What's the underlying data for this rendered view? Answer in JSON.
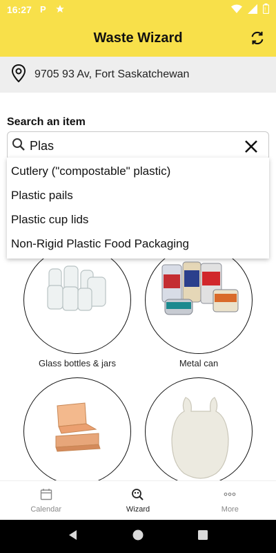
{
  "status_bar": {
    "time": "16:27",
    "icons": [
      "p-parking-icon",
      "star-icon",
      "wifi-icon",
      "signal-icon",
      "battery-icon"
    ]
  },
  "app_bar": {
    "title": "Waste Wizard",
    "action_icon": "refresh-icon"
  },
  "address": {
    "icon": "location-pin-icon",
    "text": "9705 93 Av, Fort Saskatchewan"
  },
  "search": {
    "label": "Search an item",
    "value": "Plas",
    "clear_icon": "close-icon"
  },
  "suggestions": [
    "Cutlery (\"compostable\" plastic)",
    "Plastic pails",
    "Plastic cup lids",
    "Non-Rigid Plastic Food Packaging"
  ],
  "categories": [
    {
      "label": "Glass bottles & jars",
      "icon": "glass-jars-image"
    },
    {
      "label": "Metal can",
      "icon": "metal-cans-image"
    },
    {
      "label": "",
      "icon": "cardboard-box-image"
    },
    {
      "label": "",
      "icon": "plastic-bag-image"
    }
  ],
  "bottom_nav": [
    {
      "label": "Calendar",
      "icon": "calendar-icon",
      "active": false
    },
    {
      "label": "Wizard",
      "icon": "wizard-search-icon",
      "active": true
    },
    {
      "label": "More",
      "icon": "more-dots-icon",
      "active": false
    }
  ],
  "colors": {
    "accent": "#f8e04a",
    "address_bg": "#eeeeee"
  }
}
